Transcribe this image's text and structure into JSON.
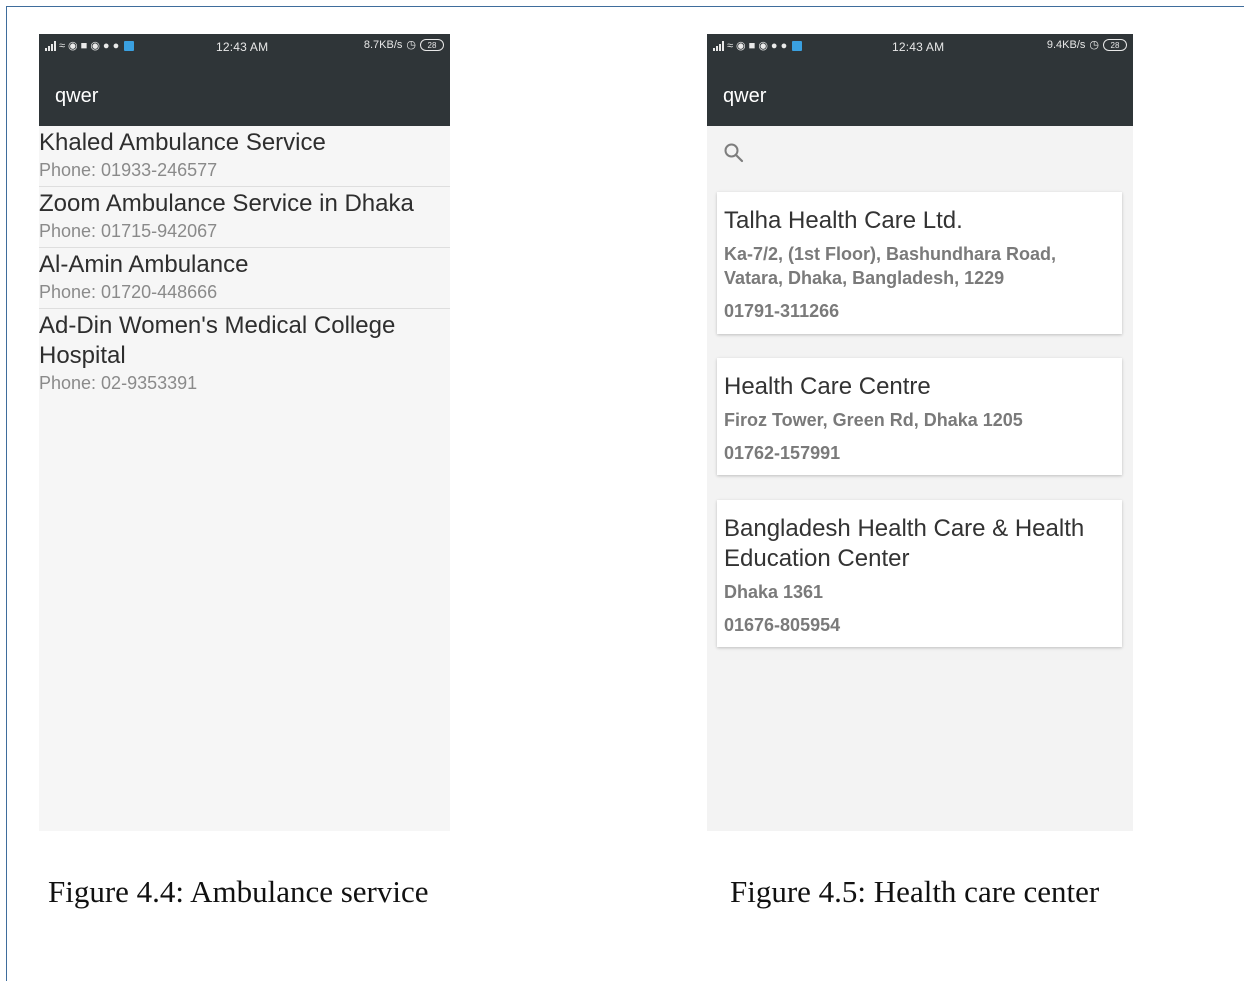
{
  "left_screen": {
    "status": {
      "time": "12:43 AM",
      "speed": "8.7KB/s",
      "battery": "28"
    },
    "app_title": "qwer",
    "items": [
      {
        "title": "Khaled Ambulance Service",
        "phone": "Phone: 01933-246577"
      },
      {
        "title": "Zoom Ambulance Service in Dhaka",
        "phone": "Phone: 01715-942067"
      },
      {
        "title": "Al-Amin Ambulance",
        "phone": "Phone:  01720-448666"
      },
      {
        "title": "Ad-Din Women's Medical College Hospital",
        "phone": "Phone: 02-9353391"
      }
    ],
    "caption": "Figure 4.4: Ambulance service"
  },
  "right_screen": {
    "status": {
      "time": "12:43 AM",
      "speed": "9.4KB/s",
      "battery": "28"
    },
    "app_title": "qwer",
    "search_icon": "search-icon",
    "cards": [
      {
        "title": "Talha Health Care Ltd.",
        "address": "Ka-7/2, (1st Floor), Bashundhara Road, Vatara, Dhaka, Bangladesh, 1229",
        "phone": "01791-311266"
      },
      {
        "title": "Health Care Centre",
        "address": "Firoz Tower, Green Rd, Dhaka 1205",
        "phone": "01762-157991"
      },
      {
        "title": "Bangladesh Health Care & Health Education Center",
        "address": "Dhaka 1361",
        "phone": "01676-805954"
      }
    ],
    "caption": "Figure 4.5: Health care center"
  },
  "colors": {
    "appbar": "#2f3538",
    "border": "#3f6d9c",
    "screen_bg": "#f6f6f6"
  }
}
